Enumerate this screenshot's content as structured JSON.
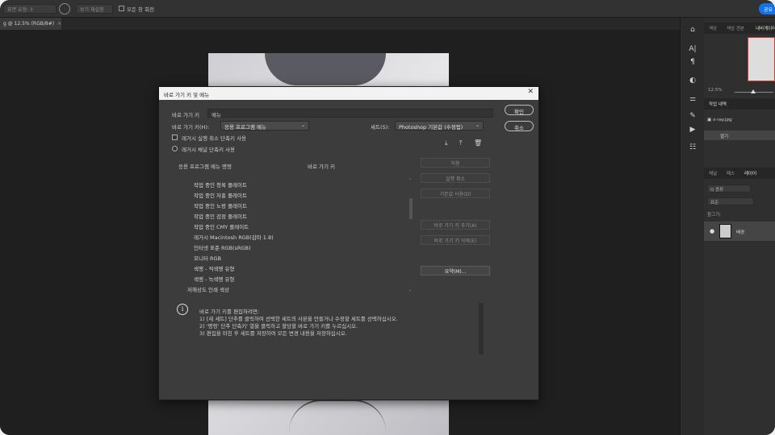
{
  "optbar": {
    "field1": "표면 유형: 3",
    "field2": "보기 재설정",
    "rotate_all_label": "모든 창 회전",
    "share_label": "공유"
  },
  "doc_tab": {
    "title": "g @ 12.5% (RGB/8#)",
    "close": "×"
  },
  "toolstrip": {
    "icons": [
      "char-icon",
      "paragraph-icon",
      "adjust-icon",
      "sliders-icon",
      "brush-icon",
      "play-icon",
      "properties-icon"
    ]
  },
  "panels": {
    "top_tabs": [
      "색상",
      "색상 견본",
      "내비게이터"
    ],
    "zoom": "12.5%",
    "history_tab": "작업 내역",
    "history_items": [
      "x-ray.jpg",
      "열기"
    ],
    "layer_tabs": [
      "채널",
      "패스",
      "레이어"
    ],
    "layer_search": "Q 종류",
    "blend_mode": "표준",
    "lock_label": "잠그기:",
    "layer_name": "배경"
  },
  "dialog": {
    "title": "바로 가기 키 및 메뉴",
    "close": "✕",
    "tab_keys": "바로 가기 키",
    "tab_menu": "메뉴",
    "ok_label": "확인",
    "cancel_label": "취소",
    "shortcut_for_label": "바로 가기 키(H):",
    "shortcut_for_value": "응용 프로그램 메뉴",
    "set_label": "세트(S):",
    "set_value": "Photoshop 기본값 (수정됨)",
    "legacy_undo_label": "레거시 실행 취소 단축키 사용",
    "legacy_channel_label": "레거시 채널 단축키 사용",
    "col_command": "응용 프로그램 메뉴 명령",
    "col_shortcut": "바로 가기 키",
    "items": [
      "작업 중인 청록 플레이트",
      "작업 중인 자홍 플레이트",
      "작업 중인 노랑 플레이트",
      "작업 중인 검정 플레이트",
      "작업 중인 CMY 플레이트",
      "레거시 Macintosh RGB(감마 1.8)",
      "인터넷 표준 RGB(sRGB)",
      "모니터 RGB",
      "색맹 - 적색맹 유형",
      "색맹 - 녹색맹 유형",
      "저해상도 인쇄 색상"
    ],
    "btn_accept": "허용",
    "btn_undo": "실행 취소",
    "btn_default": "기본값 사용(D)",
    "btn_add": "바로 가기 키 추가(A)",
    "btn_delete": "바로 가기 키 삭제(E)",
    "btn_summary": "요약(M)...",
    "info_lines": [
      "바로 가기 키를 편집하려면:",
      "1) [새 세트] 단추를 클릭하여 선택한 세트의 사본을 만들거나 수정할 세트를 선택하십시오.",
      "2) '명령' 단추 단축키' 열을 클릭하고 할당할 바로 가기 키를 누르십시오.",
      "3) 편집을 마친 후 세트를 저장하여 모든 변경 내용을 저장하십시오."
    ]
  }
}
